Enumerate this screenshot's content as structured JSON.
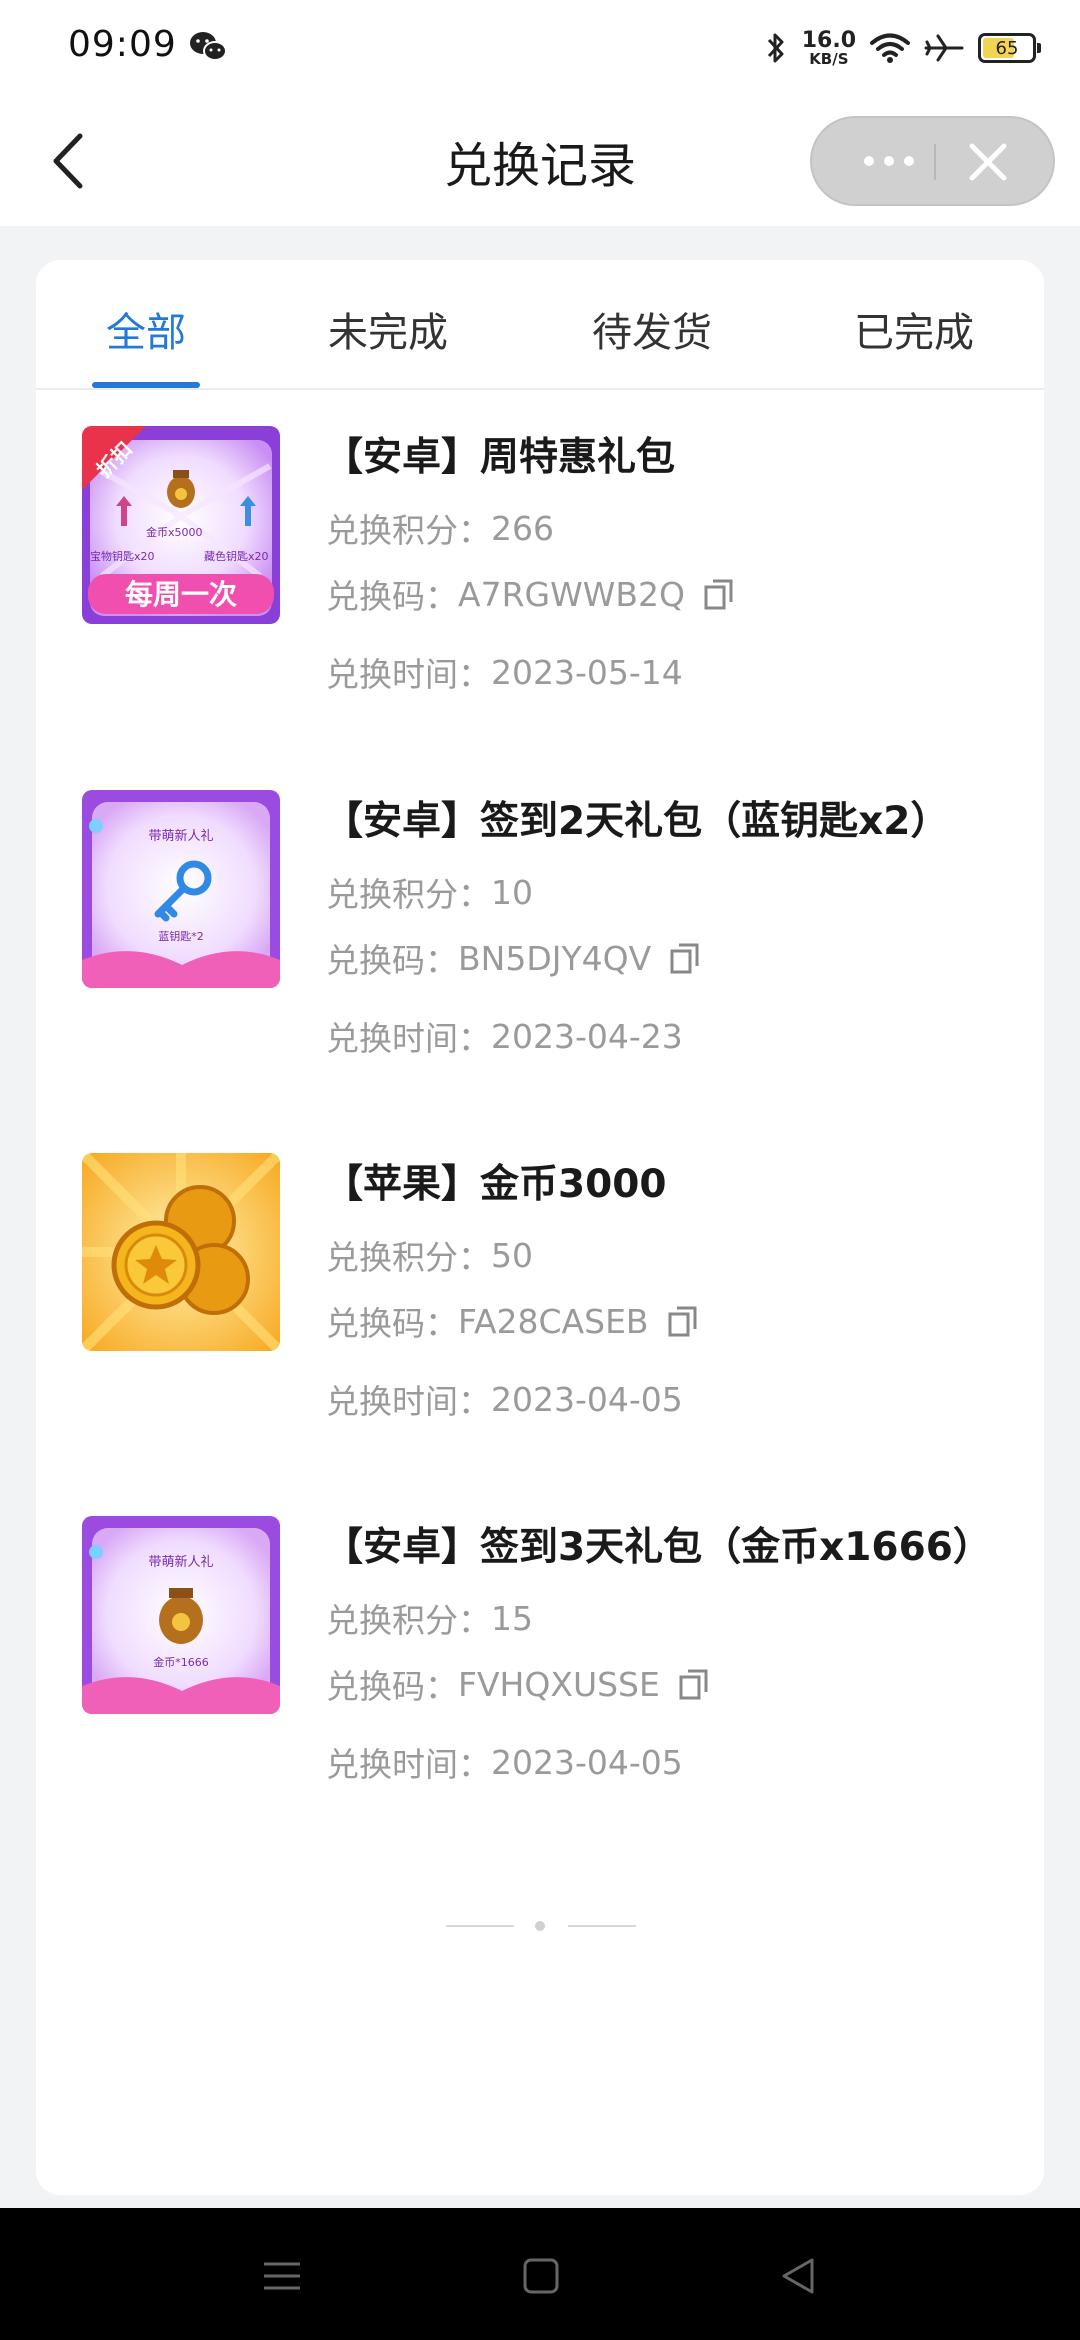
{
  "status_bar": {
    "time": "09:09",
    "network_speed": "16.0",
    "network_unit": "KB/S",
    "battery": "65",
    "battery_level": 0.65,
    "icons": [
      "wechat-icon",
      "bluetooth-icon",
      "wifi-icon",
      "airplane-icon",
      "battery-icon"
    ]
  },
  "header": {
    "title": "兑换记录",
    "back_icon": "chevron-left-icon",
    "more_icon": "more-dots-icon",
    "close_icon": "close-icon"
  },
  "tabs": [
    {
      "label": "全部",
      "active": true
    },
    {
      "label": "未完成",
      "active": false
    },
    {
      "label": "待发货",
      "active": false
    },
    {
      "label": "已完成",
      "active": false
    }
  ],
  "labels": {
    "points": "兑换积分：",
    "code": "兑换码：",
    "time": "兑换时间："
  },
  "records": [
    {
      "title": "【安卓】周特惠礼包",
      "points": "266",
      "code": "A7RGWWB2Q",
      "time": "2023-05-14",
      "image": {
        "type": "weekly-pack",
        "ribbon": "折扣",
        "banner": "每周一次",
        "cap1": "宝物钥匙x20",
        "cap2": "金币x5000",
        "cap3": "藏色钥匙x20"
      }
    },
    {
      "title": "【安卓】签到2天礼包（蓝钥匙x2）",
      "points": "10",
      "code": "BN5DJY4QV",
      "time": "2023-04-23",
      "image": {
        "type": "newbie-key",
        "header": "带萌新人礼",
        "caption": "蓝钥匙*2"
      }
    },
    {
      "title": "【苹果】金币3000",
      "points": "50",
      "code": "FA28CASEB",
      "time": "2023-04-05",
      "image": {
        "type": "coins"
      }
    },
    {
      "title": "【安卓】签到3天礼包（金币x1666）",
      "points": "15",
      "code": "FVHQXUSSE",
      "time": "2023-04-05",
      "image": {
        "type": "newbie-bag",
        "header": "带萌新人礼",
        "caption": "金币*1666"
      }
    }
  ],
  "colors": {
    "accent": "#2478d6",
    "background": "#f2f3f5",
    "muted_text": "#9a9a9a"
  },
  "system_nav": [
    "menu-icon",
    "home-square-icon",
    "back-triangle-icon"
  ]
}
